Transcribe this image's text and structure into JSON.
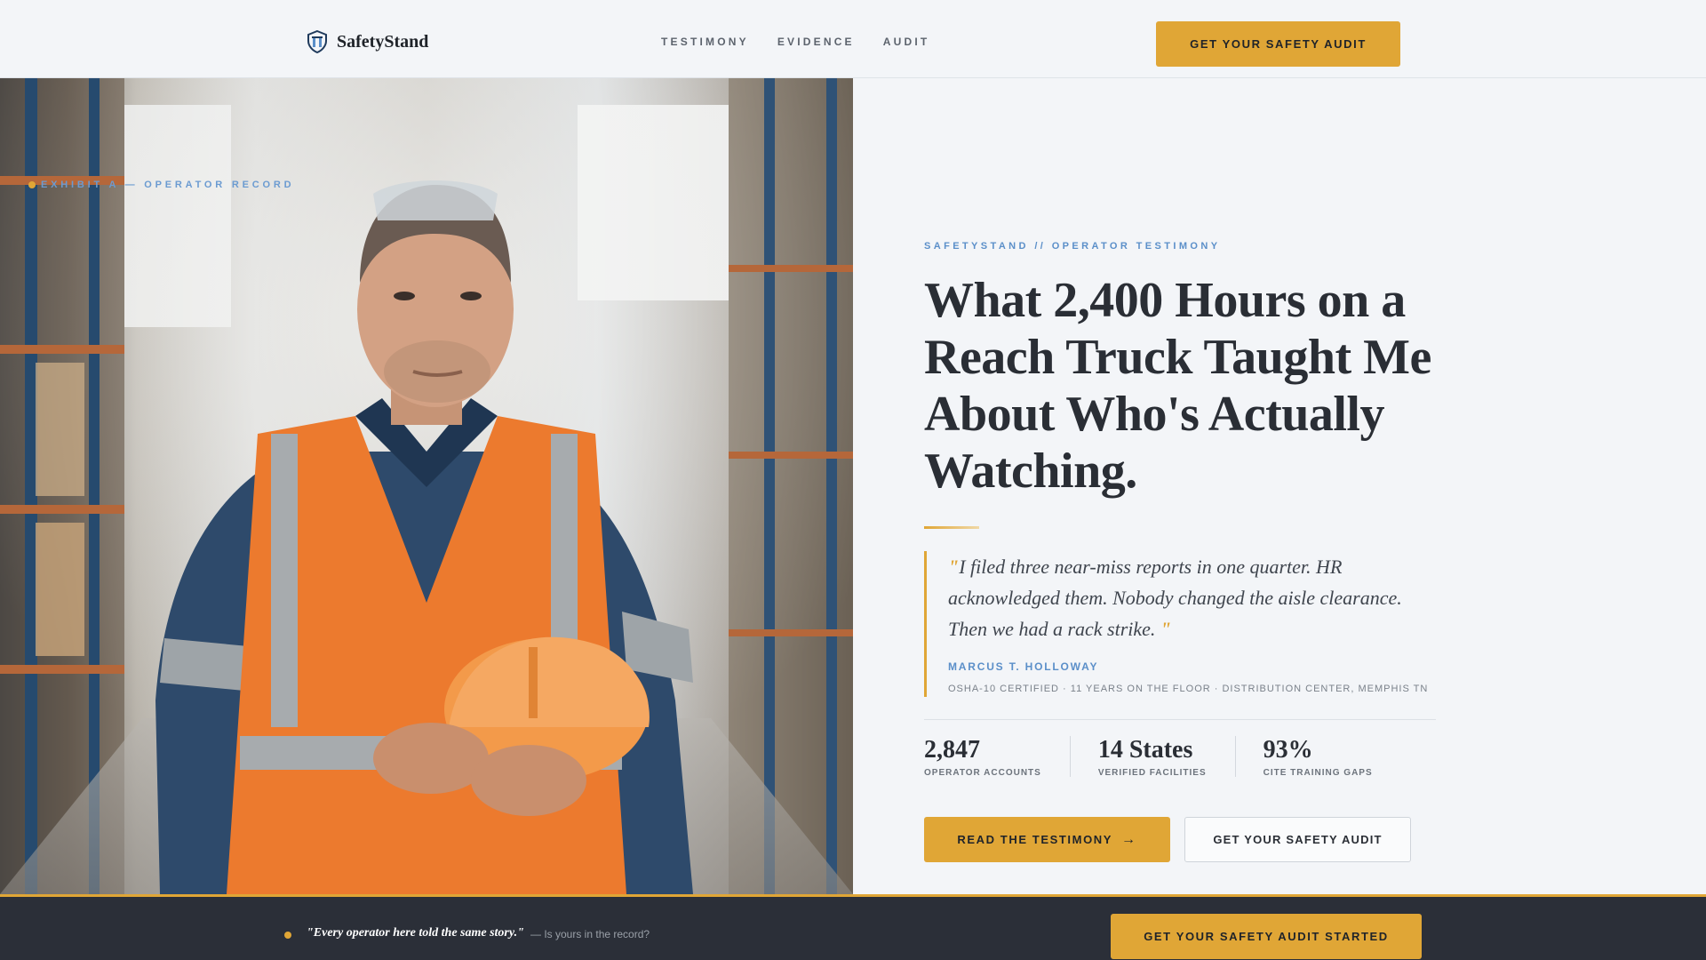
{
  "header": {
    "brand": "SafetyStand",
    "nav": [
      "TESTIMONY",
      "EVIDENCE",
      "AUDIT"
    ],
    "cta": "GET YOUR SAFETY AUDIT"
  },
  "photo": {
    "exhibit_label": "EXHIBIT A — OPERATOR RECORD"
  },
  "hero": {
    "eyebrow": "SAFETYSTAND // OPERATOR TESTIMONY",
    "headline": "What 2,400 Hours on a Reach Truck Taught Me About Who's Actually Watching.",
    "quote": "I filed three near-miss reports in one quarter. HR acknowledged them. Nobody changed the aisle clearance. Then we had a rack strike.",
    "author": "MARCUS T. HOLLOWAY",
    "credentials": "OSHA-10 CERTIFIED · 11 YEARS ON THE FLOOR · DISTRIBUTION CENTER, MEMPHIS TN",
    "stats": [
      {
        "value": "2,847",
        "label": "OPERATOR ACCOUNTS"
      },
      {
        "value": "14 States",
        "label": "VERIFIED FACILITIES"
      },
      {
        "value": "93%",
        "label": "CITE TRAINING GAPS"
      }
    ],
    "primary_cta": "READ THE TESTIMONY",
    "secondary_cta": "GET YOUR SAFETY AUDIT"
  },
  "bottom_bar": {
    "quote": "\"Every operator here told the same story.\"",
    "sub": "— Is yours in the record?",
    "cta": "GET YOUR SAFETY AUDIT STARTED"
  },
  "colors": {
    "accent": "#e0a636",
    "link_blue": "#5b8fc9",
    "dark": "#2b2f38",
    "background": "#f3f5f8"
  }
}
